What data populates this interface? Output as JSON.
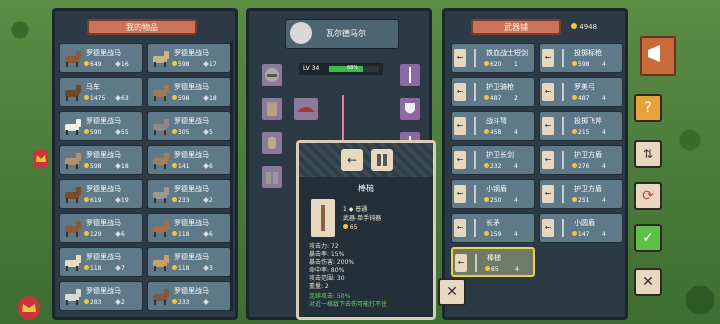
{
  "inventory": {
    "title": "我的物品",
    "items": [
      {
        "name": "罗德里战马",
        "price": "649",
        "qty": "16",
        "color": "#8a5a3a"
      },
      {
        "name": "罗德里战马",
        "price": "598",
        "qty": "17",
        "color": "#c9b48a"
      },
      {
        "name": "马车",
        "price": "1475",
        "qty": "63",
        "color": "#6b4a2a"
      },
      {
        "name": "罗德里战马",
        "price": "598",
        "qty": "18",
        "color": "#9a7a5a"
      },
      {
        "name": "罗德里战马",
        "price": "590",
        "qty": "55",
        "color": "#f2efe8"
      },
      {
        "name": "罗德里战马",
        "price": "305",
        "qty": "5",
        "color": "#8a8a8a"
      },
      {
        "name": "罗德里战马",
        "price": "598",
        "qty": "18",
        "color": "#b09070"
      },
      {
        "name": "罗德里战马",
        "price": "141",
        "qty": "6",
        "color": "#a08060"
      },
      {
        "name": "罗德里战马",
        "price": "619",
        "qty": "19",
        "color": "#7a4a2a"
      },
      {
        "name": "罗德里战马",
        "price": "233",
        "qty": "2",
        "color": "#9a9a9a"
      },
      {
        "name": "罗德里战马",
        "price": "129",
        "qty": "6",
        "color": "#8a5a3a"
      },
      {
        "name": "罗德里战马",
        "price": "118",
        "qty": "6",
        "color": "#a07050"
      },
      {
        "name": "罗德里战马",
        "price": "118",
        "qty": "7",
        "color": "#e8dcc0"
      },
      {
        "name": "罗德里战马",
        "price": "118",
        "qty": "3",
        "color": "#c8a070"
      },
      {
        "name": "罗德里战马",
        "price": "283",
        "qty": "2",
        "color": "#d8d8d8"
      },
      {
        "name": "罗德里战马",
        "price": "233",
        "qty": "",
        "color": "#7a5a40"
      }
    ]
  },
  "character": {
    "name": "瓦尔德马尔",
    "level": "LV 34",
    "hp": "68%",
    "hp_fraction": 0.68
  },
  "shop": {
    "title": "武器铺",
    "gold": "4948",
    "items": [
      {
        "name": "铁血战士短剑",
        "price": "620",
        "qty": "1"
      },
      {
        "name": "投掷标枪",
        "price": "598",
        "qty": "4"
      },
      {
        "name": "护卫骑枪",
        "price": "487",
        "qty": "2"
      },
      {
        "name": "罗美弓",
        "price": "487",
        "qty": "4"
      },
      {
        "name": "战斗弩",
        "price": "458",
        "qty": "4"
      },
      {
        "name": "投掷飞斧",
        "price": "215",
        "qty": "4"
      },
      {
        "name": "护卫长剑",
        "price": "232",
        "qty": "4"
      },
      {
        "name": "护卫方盾",
        "price": "276",
        "qty": "4"
      },
      {
        "name": "小钢盾",
        "price": "250",
        "qty": "4"
      },
      {
        "name": "护卫方盾",
        "price": "251",
        "qty": "4"
      },
      {
        "name": "长矛",
        "price": "159",
        "qty": "4"
      },
      {
        "name": "小圆盾",
        "price": "147",
        "qty": "4"
      },
      {
        "name": "棒槌",
        "price": "65",
        "qty": "4"
      }
    ]
  },
  "detail": {
    "title": "棒槌",
    "count": "1",
    "rarity": "普通",
    "type": "武器-单手钝器",
    "price": "65",
    "stats": [
      "攻击力: 72",
      "暴击率: 15%",
      "暴击伤害: 200%",
      "命中率: 80%",
      "攻击范围: 30",
      "重量: 2"
    ],
    "bonus": [
      "连续攻击: 50%",
      "对近一格敌下去伤可能打不住"
    ]
  },
  "colors": {
    "panel": "#2b3a45",
    "slot": "#5e7a88",
    "accent": "#c8735a",
    "selected_border": "#e8d24a",
    "hp_green": "#3fb84a"
  }
}
